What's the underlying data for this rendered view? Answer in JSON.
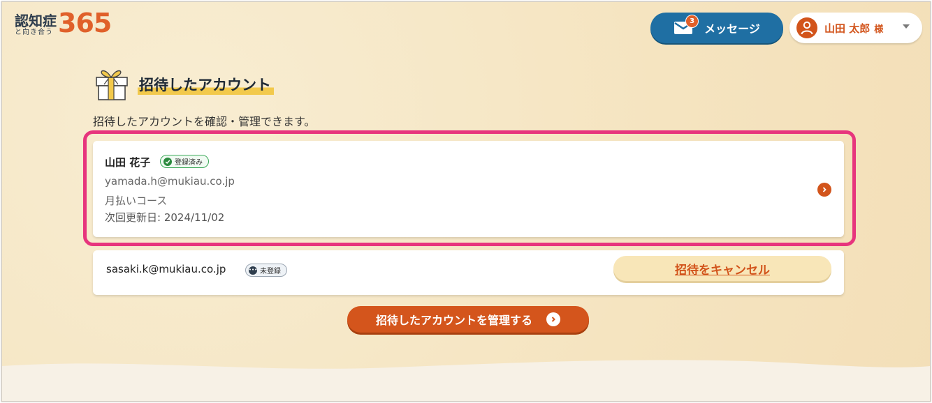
{
  "logo": {
    "main": "認知症",
    "sub": "と向き合う",
    "number": "365"
  },
  "header": {
    "messages_label": "メッセージ",
    "messages_count": "3",
    "user_name": "山田 太郎",
    "user_suffix": "様"
  },
  "section": {
    "title": "招待したアカウント",
    "description": "招待したアカウントを確認・管理できます。"
  },
  "accounts": [
    {
      "name": "山田 花子",
      "status": "登録済み",
      "email": "yamada.h@mukiau.co.jp",
      "plan": "月払いコース",
      "renewal": "次回更新日: 2024/11/02"
    },
    {
      "email": "sasaki.k@mukiau.co.jp",
      "status": "未登録",
      "cancel_label": "招待をキャンセル"
    }
  ],
  "manage_button": "招待したアカウントを管理する",
  "colors": {
    "accent": "#d2541b",
    "message_button": "#1f6fa3",
    "highlight": "#e7357d",
    "background": "#f6e8c8"
  }
}
